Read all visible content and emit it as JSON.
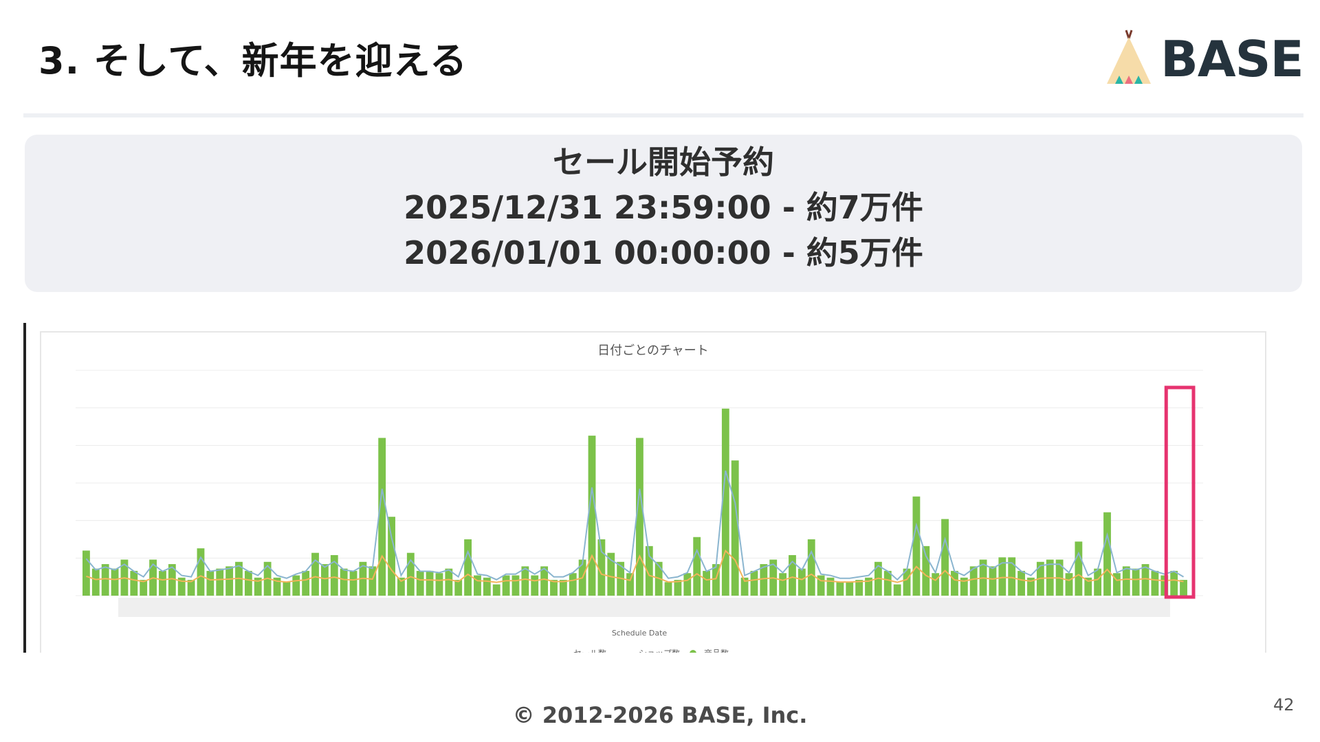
{
  "slide": {
    "title": "3. そして、新年を迎える",
    "logo_text": "BASE",
    "page_number": "42",
    "copyright": "© 2012-2026 BASE, Inc."
  },
  "info_box": {
    "heading": "セール開始予約",
    "line1": "2025/12/31 23:59:00 - 約7万件",
    "line2": "2026/01/01 00:00:00 - 約5万件"
  },
  "colors": {
    "bars": "#7cc24a",
    "sale_line": "#8ab5cf",
    "shop_line": "#f2b45a",
    "highlight": "#e6336f",
    "logo_dark": "#25333d"
  },
  "chart_data": {
    "type": "bar",
    "title": "日付ごとのチャート",
    "xlabel": "Schedule Date",
    "ylim": [
      0,
      100
    ],
    "legend": [
      "セール数",
      "ショップ数",
      "商品数"
    ],
    "legend_position": "bottom",
    "highlight_last_n": 2,
    "series": [
      {
        "name": "商品数",
        "kind": "bar",
        "values": [
          20,
          12,
          14,
          12,
          16,
          11,
          7,
          16,
          11,
          14,
          8,
          7,
          21,
          11,
          12,
          13,
          15,
          11,
          8,
          15,
          8,
          6,
          9,
          11,
          19,
          14,
          18,
          12,
          11,
          15,
          13,
          70,
          35,
          8,
          19,
          11,
          11,
          10,
          12,
          7,
          25,
          9,
          8,
          5,
          9,
          9,
          13,
          9,
          13,
          7,
          7,
          10,
          16,
          71,
          25,
          19,
          15,
          10,
          70,
          22,
          15,
          6,
          7,
          10,
          26,
          11,
          14,
          83,
          60,
          8,
          11,
          14,
          16,
          10,
          18,
          12,
          25,
          9,
          8,
          6,
          6,
          7,
          8,
          15,
          11,
          5,
          12,
          44,
          22,
          10,
          34,
          11,
          8,
          13,
          16,
          13,
          17,
          17,
          11,
          8,
          15,
          16,
          16,
          10,
          24,
          8,
          12,
          37,
          10,
          13,
          12,
          14,
          11,
          9,
          11,
          7,
          12,
          10,
          5,
          9,
          6,
          4,
          9,
          10,
          7,
          5,
          9,
          6,
          14,
          7,
          15,
          10,
          14,
          8,
          19,
          14,
          5,
          19,
          9,
          13,
          12,
          14,
          20,
          30,
          8,
          23,
          14,
          8,
          14,
          11,
          8,
          7,
          20,
          18,
          14,
          9,
          17,
          9,
          13,
          21,
          9,
          3,
          4,
          12,
          16,
          17,
          14,
          16,
          13,
          11,
          9,
          14,
          15,
          12,
          8,
          9,
          15,
          8,
          6,
          14,
          18,
          7,
          11,
          12,
          10,
          4,
          20,
          22,
          15,
          13,
          26,
          22,
          7,
          18,
          5,
          9,
          10,
          16,
          26,
          24,
          24,
          17,
          25,
          20,
          24,
          17,
          16,
          12,
          10,
          18,
          11,
          15,
          8,
          20,
          13,
          30,
          11,
          9,
          8,
          10,
          6,
          11,
          5,
          13,
          9,
          10,
          12,
          9,
          8,
          4,
          15,
          7,
          11,
          14,
          9,
          17,
          15,
          10,
          13,
          10,
          7,
          11,
          12,
          6,
          10,
          5,
          8,
          6,
          4
        ]
      },
      {
        "name": "セール数",
        "kind": "line",
        "values": []
      },
      {
        "name": "ショップ数",
        "kind": "line",
        "values": []
      }
    ]
  }
}
